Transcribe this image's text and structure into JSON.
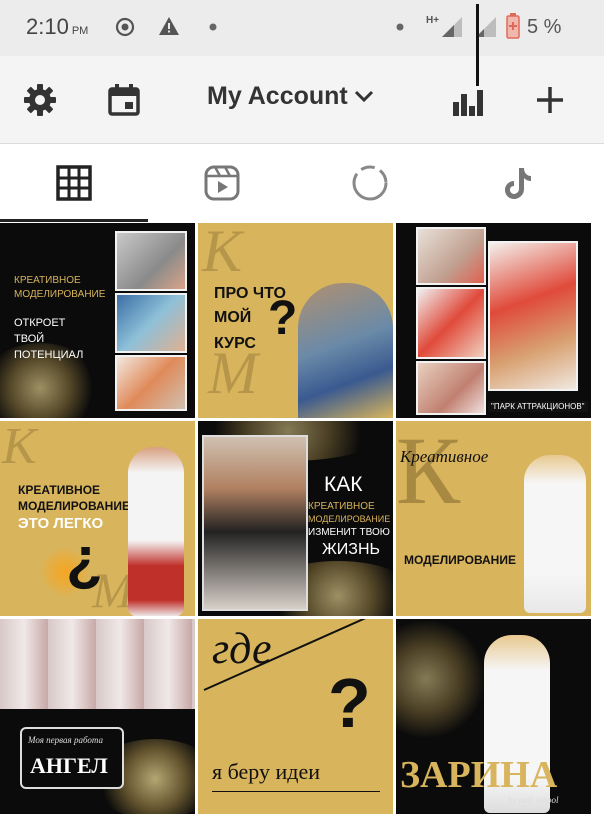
{
  "status_bar": {
    "time": "2:10",
    "ampm": "PM",
    "network": "H+",
    "battery_percent": "5 %",
    "icons": [
      "sync-icon",
      "warning-icon",
      "notification-dot-icon",
      "signal-icon",
      "battery-low-icon"
    ]
  },
  "top_bar": {
    "account_label": "My Account",
    "icons": [
      "settings-gear-icon",
      "calendar-icon",
      "chevron-down-icon",
      "insights-bar-chart-icon",
      "add-plus-icon"
    ]
  },
  "tabs": [
    {
      "name": "grid",
      "icon": "grid-icon",
      "active": true
    },
    {
      "name": "reels",
      "icon": "reels-icon",
      "active": false
    },
    {
      "name": "stories",
      "icon": "stories-circle-icon",
      "active": false
    },
    {
      "name": "tiktok",
      "icon": "tiktok-icon",
      "active": false
    }
  ],
  "posts": {
    "p1": {
      "line1": "КРЕАТИВНОЕ",
      "line2": "МОДЕЛИРОВАНИЕ",
      "line3": "ОТКРОЕТ",
      "line4": "ТВОЙ",
      "line5": "ПОТЕНЦИАЛ"
    },
    "p2": {
      "line1": "ПРО ЧТО",
      "line2": "МОЙ",
      "line3": "КУРС",
      "mark": "?",
      "letter1": "К",
      "letter2": "М"
    },
    "p3": {
      "caption": "\"ПАРК АТТРАКЦИОНОВ\""
    },
    "p4": {
      "line1": "КРЕАТИВНОЕ",
      "line2": "МОДЕЛИРОВАНИЕ",
      "line3": "ЭТО ЛЕГКО",
      "mark": "?",
      "letter1": "К",
      "letter2": "М"
    },
    "p5": {
      "line1": "КАК",
      "line2": "КРЕАТИВНОЕ",
      "line3": "МОДЕЛИРОВАНИЕ",
      "line4": "ИЗМЕНИТ ТВОЮ",
      "line5": "ЖИЗНЬ"
    },
    "p6": {
      "script": "Креативное",
      "letter": "К",
      "caption": "МОДЕЛИРОВАНИЕ"
    },
    "p7": {
      "subtitle": "Моя первая работа",
      "title": "АНГЕЛ"
    },
    "p8": {
      "script": "где",
      "mark": "?",
      "caption": "я беру идеи"
    },
    "p9": {
      "title": "ЗАРИНА",
      "subtitle": "by nail school"
    }
  },
  "colors": {
    "gold": "#d8b45c",
    "black": "#0b0b0b",
    "status_bg": "#ececec",
    "bar_bg": "#f4f4f4",
    "battery": "#e06a5a"
  }
}
